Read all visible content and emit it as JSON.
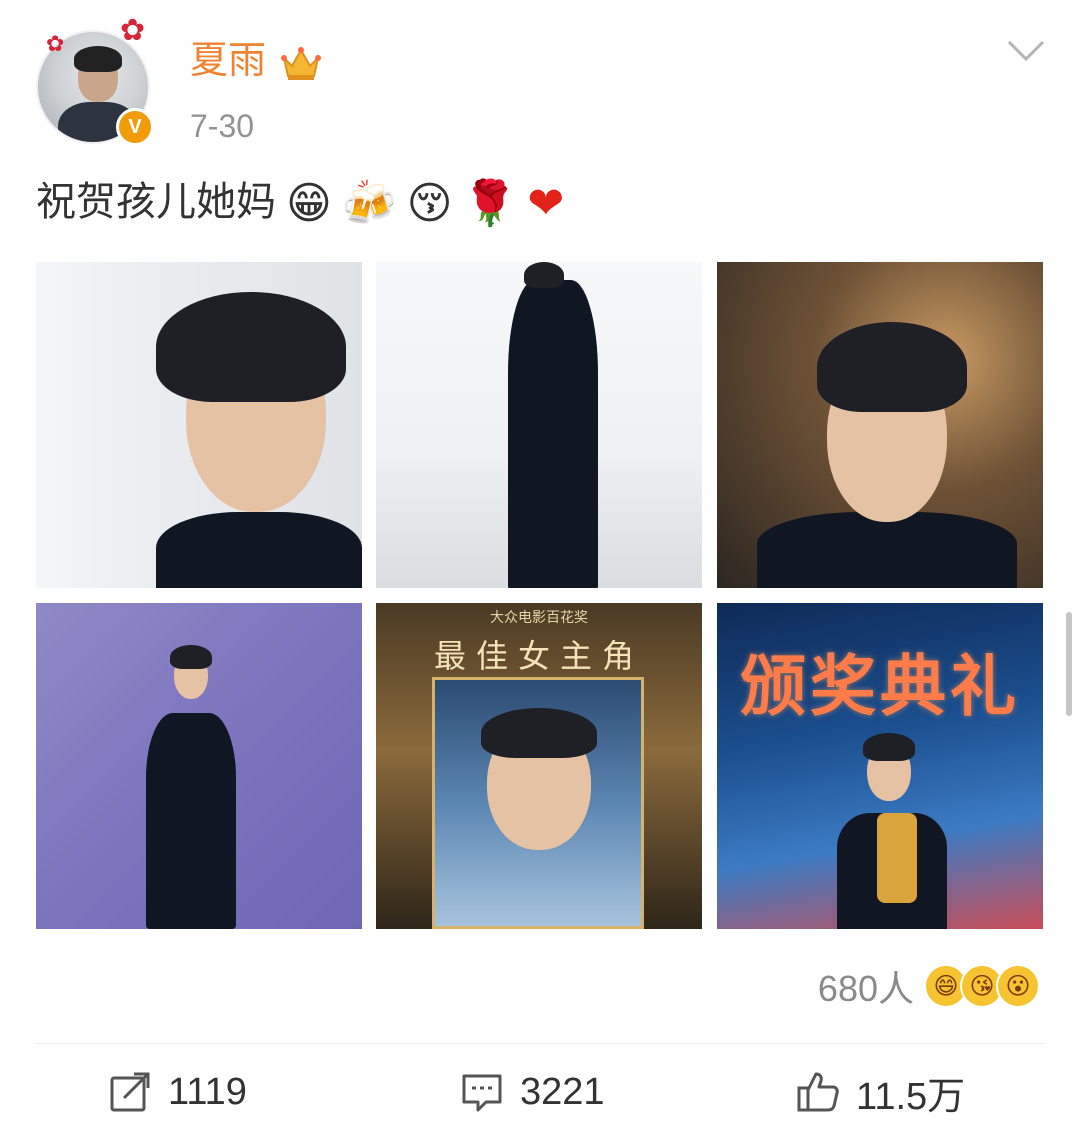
{
  "post": {
    "username": "夏雨",
    "time": "7-30",
    "text": "祝贺孩儿她妈",
    "emojis": {
      "grin": "😁",
      "beers": "🍻",
      "blush_kiss": "😚",
      "rose": "🌹",
      "heart": "❤"
    }
  },
  "images": {
    "poster_sub": "大众电影百花奖",
    "poster_title": "最佳女主角",
    "ceremony_text": "颁奖典礼"
  },
  "reactions": {
    "count_label": "680人",
    "icons": [
      "😄",
      "😘",
      "😮"
    ]
  },
  "actions": {
    "share_count": "1119",
    "comment_count": "3221",
    "like_count": "11.5万"
  },
  "colors": {
    "username": "#f08332",
    "verified": "#f39c0b",
    "text": "#333333",
    "meta": "#939393"
  }
}
